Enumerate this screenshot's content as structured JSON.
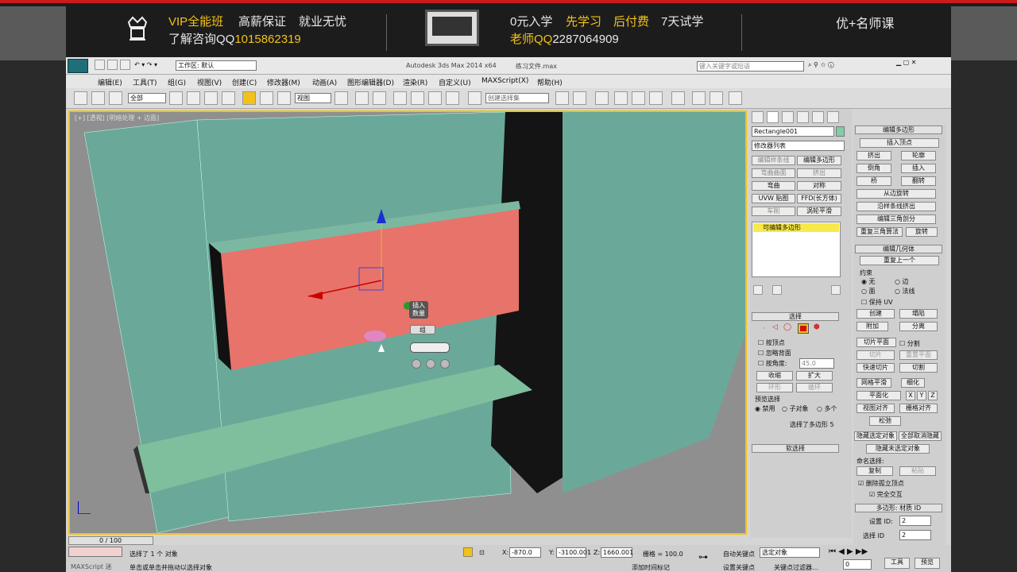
{
  "banner": {
    "vip": "VIP全能班",
    "slogan1": "高薪保证",
    "slogan2": "就业无忧",
    "consult_label": "了解咨询QQ",
    "consult_qq": "1015862319",
    "offer1": "0元入学",
    "offer2": "先学习",
    "offer3": "后付费",
    "offer4": "7天试学",
    "teacher_label": "老师QQ",
    "teacher_qq": "2287064909",
    "brand": "优+名师课"
  },
  "titlebar": {
    "workspace_label": "工作区: 默认",
    "app_title": "Autodesk 3ds Max  2014 x64",
    "file_title": "练习文件.max",
    "search_placeholder": "键入关键字或短语"
  },
  "menu": [
    "编辑(E)",
    "工具(T)",
    "组(G)",
    "视图(V)",
    "创建(C)",
    "修改器(M)",
    "动画(A)",
    "图形编辑器(D)",
    "渲染(R)",
    "自定义(U)",
    "MAXScript(X)",
    "帮助(H)"
  ],
  "toolbar": {
    "filter": "全部",
    "view": "视图",
    "selection_set": "创建选择集"
  },
  "viewport": {
    "label": "[+] [透视] [明暗处理 + 边面]",
    "caddy_title": "插入",
    "caddy_sub": "数量",
    "caddy_value": "组"
  },
  "cmd_panel": {
    "object_name": "Rectangle001",
    "modifier_list": "修改器列表",
    "mod_buttons": [
      "编辑样条线",
      "编辑多边形",
      "弯曲曲面",
      "挤出",
      "弯曲",
      "对称",
      "UVW 贴图",
      "FFD(长方体)",
      "车削",
      "涡轮平滑"
    ],
    "stack_item": "可编辑多边形",
    "selection_header": "选择",
    "by_vertex": "按顶点",
    "ignore_back": "忽略背面",
    "by_angle": "按角度:",
    "angle_value": "45.0",
    "shrink": "收缩",
    "grow": "扩大",
    "ring": "环形",
    "loop": "循环",
    "preview_label": "预览选择",
    "preview_opts": [
      "禁用",
      "子对象",
      "多个"
    ],
    "selected_text": "选择了多边形 5",
    "soft_select": "软选择"
  },
  "cmd_panel2": {
    "edit_poly_header": "编辑多边形",
    "insert_vertex": "插入顶点",
    "rows": [
      [
        "挤出",
        "轮廓"
      ],
      [
        "倒角",
        "插入"
      ],
      [
        "桥",
        "翻转"
      ]
    ],
    "from_edge": "从边旋转",
    "along_spline": "沿样条线挤出",
    "edit_tri": "编辑三角剖分",
    "retri": "重复三角算法",
    "turn": "旋转",
    "geom_header": "编辑几何体",
    "repeat_last": "重复上一个",
    "constraint_label": "约束",
    "constraints": [
      "无",
      "边",
      "面",
      "法线"
    ],
    "keep_uv": "保持 UV",
    "create": "创建",
    "collapse": "塌陷",
    "attach": "附加",
    "detach": "分离",
    "slice_plane": "切片平面",
    "split": "分割",
    "slice": "切片",
    "reset_plane": "重置平面",
    "quickslice": "快速切片",
    "cut": "切割",
    "meshsmooth": "网格平滑",
    "tessellate": "细化",
    "planar": "平面化",
    "x": "X",
    "y": "Y",
    "z": "Z",
    "view_align": "视图对齐",
    "grid_align": "栅格对齐",
    "relax": "松弛",
    "hide_sel": "隐藏选定对象",
    "unhide_all": "全部取消隐藏",
    "hide_unsel": "隐藏未选定对象",
    "named_sel": "命名选择:",
    "copy": "复制",
    "paste": "粘贴",
    "delete_iso": "删除孤立顶点",
    "full_interact": "完全交互",
    "mat_header": "多边形: 材质 ID",
    "set_id_label": "设置 ID:",
    "set_id": "2",
    "select_id_label": "选择 ID",
    "select_id": "2"
  },
  "status": {
    "timeline": "0 / 100",
    "maxscript": "MAXScript 迷",
    "selected": "选择了 1 个 对象",
    "prompt": "单击或单击并拖动以选择对象",
    "x_label": "X:",
    "x": "-870.0",
    "y_label": "Y:",
    "y": "-3100.001",
    "z_label": "Z:",
    "z": "1660.001",
    "grid": "栅格 = 100.0",
    "add_tag": "添加时间标记",
    "auto_key": "自动关键点",
    "set_key": "设置关键点",
    "sel_obj": "选定对象",
    "key_filter": "关键点过滤器...",
    "frame": "0",
    "tools": "工具",
    "preview": "预览"
  }
}
